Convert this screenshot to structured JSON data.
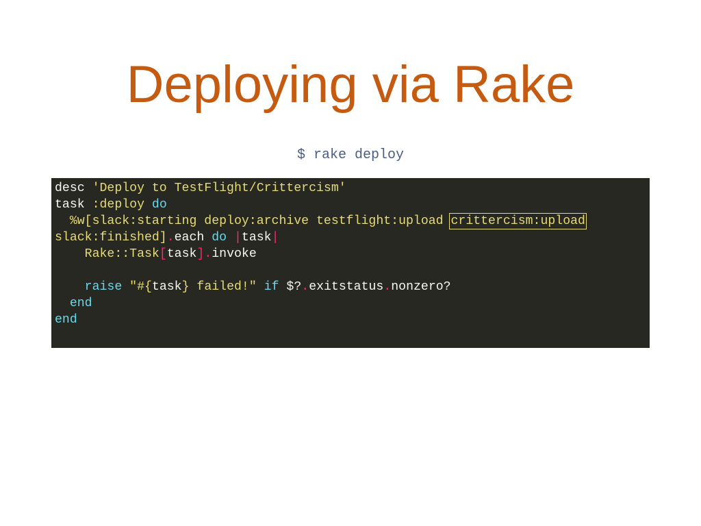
{
  "slide": {
    "title": "Deploying via Rake",
    "command": "$ rake deploy"
  },
  "code": {
    "language": "ruby",
    "lines": [
      [
        {
          "text": "desc ",
          "kind": "plain"
        },
        {
          "text": "'Deploy to TestFlight/Crittercism'",
          "kind": "str"
        }
      ],
      [
        {
          "text": "task ",
          "kind": "plain"
        },
        {
          "text": ":deploy",
          "kind": "sym"
        },
        {
          "text": " ",
          "kind": "plain"
        },
        {
          "text": "do",
          "kind": "kw"
        }
      ],
      [
        {
          "text": "  ",
          "kind": "plain"
        },
        {
          "text": "%w[slack:starting deploy:archive testflight:upload ",
          "kind": "str"
        },
        {
          "text": "crittercism:upload",
          "kind": "highlight"
        }
      ],
      [
        {
          "text": "slack:finished]",
          "kind": "str"
        },
        {
          "text": ".",
          "kind": "op"
        },
        {
          "text": "each ",
          "kind": "plain"
        },
        {
          "text": "do",
          "kind": "kw"
        },
        {
          "text": " ",
          "kind": "plain"
        },
        {
          "text": "|",
          "kind": "op"
        },
        {
          "text": "task",
          "kind": "plain"
        },
        {
          "text": "|",
          "kind": "op"
        }
      ],
      [
        {
          "text": "    ",
          "kind": "plain"
        },
        {
          "text": "Rake::Task",
          "kind": "const"
        },
        {
          "text": "[",
          "kind": "op"
        },
        {
          "text": "task",
          "kind": "plain"
        },
        {
          "text": "]",
          "kind": "op"
        },
        {
          "text": ".",
          "kind": "op"
        },
        {
          "text": "invoke",
          "kind": "plain"
        }
      ],
      [
        {
          "text": "",
          "kind": "plain"
        }
      ],
      [
        {
          "text": "    ",
          "kind": "plain"
        },
        {
          "text": "raise",
          "kind": "kw"
        },
        {
          "text": " ",
          "kind": "plain"
        },
        {
          "text": "\"#{",
          "kind": "str"
        },
        {
          "text": "task",
          "kind": "plain"
        },
        {
          "text": "} failed!\"",
          "kind": "str"
        },
        {
          "text": " ",
          "kind": "plain"
        },
        {
          "text": "if",
          "kind": "kw"
        },
        {
          "text": " $?",
          "kind": "plain"
        },
        {
          "text": ".",
          "kind": "op"
        },
        {
          "text": "exitstatus",
          "kind": "plain"
        },
        {
          "text": ".",
          "kind": "op"
        },
        {
          "text": "nonzero?",
          "kind": "plain"
        }
      ],
      [
        {
          "text": "  ",
          "kind": "plain"
        },
        {
          "text": "end",
          "kind": "kw"
        }
      ],
      [
        {
          "text": "end",
          "kind": "kw"
        }
      ]
    ]
  },
  "colors": {
    "title": "#c55a11",
    "command": "#4a5e82",
    "code_background": "#272822",
    "string": "#e6db74",
    "keyword": "#66d9ef",
    "operator": "#f92672",
    "plain": "#f8f8f2"
  }
}
